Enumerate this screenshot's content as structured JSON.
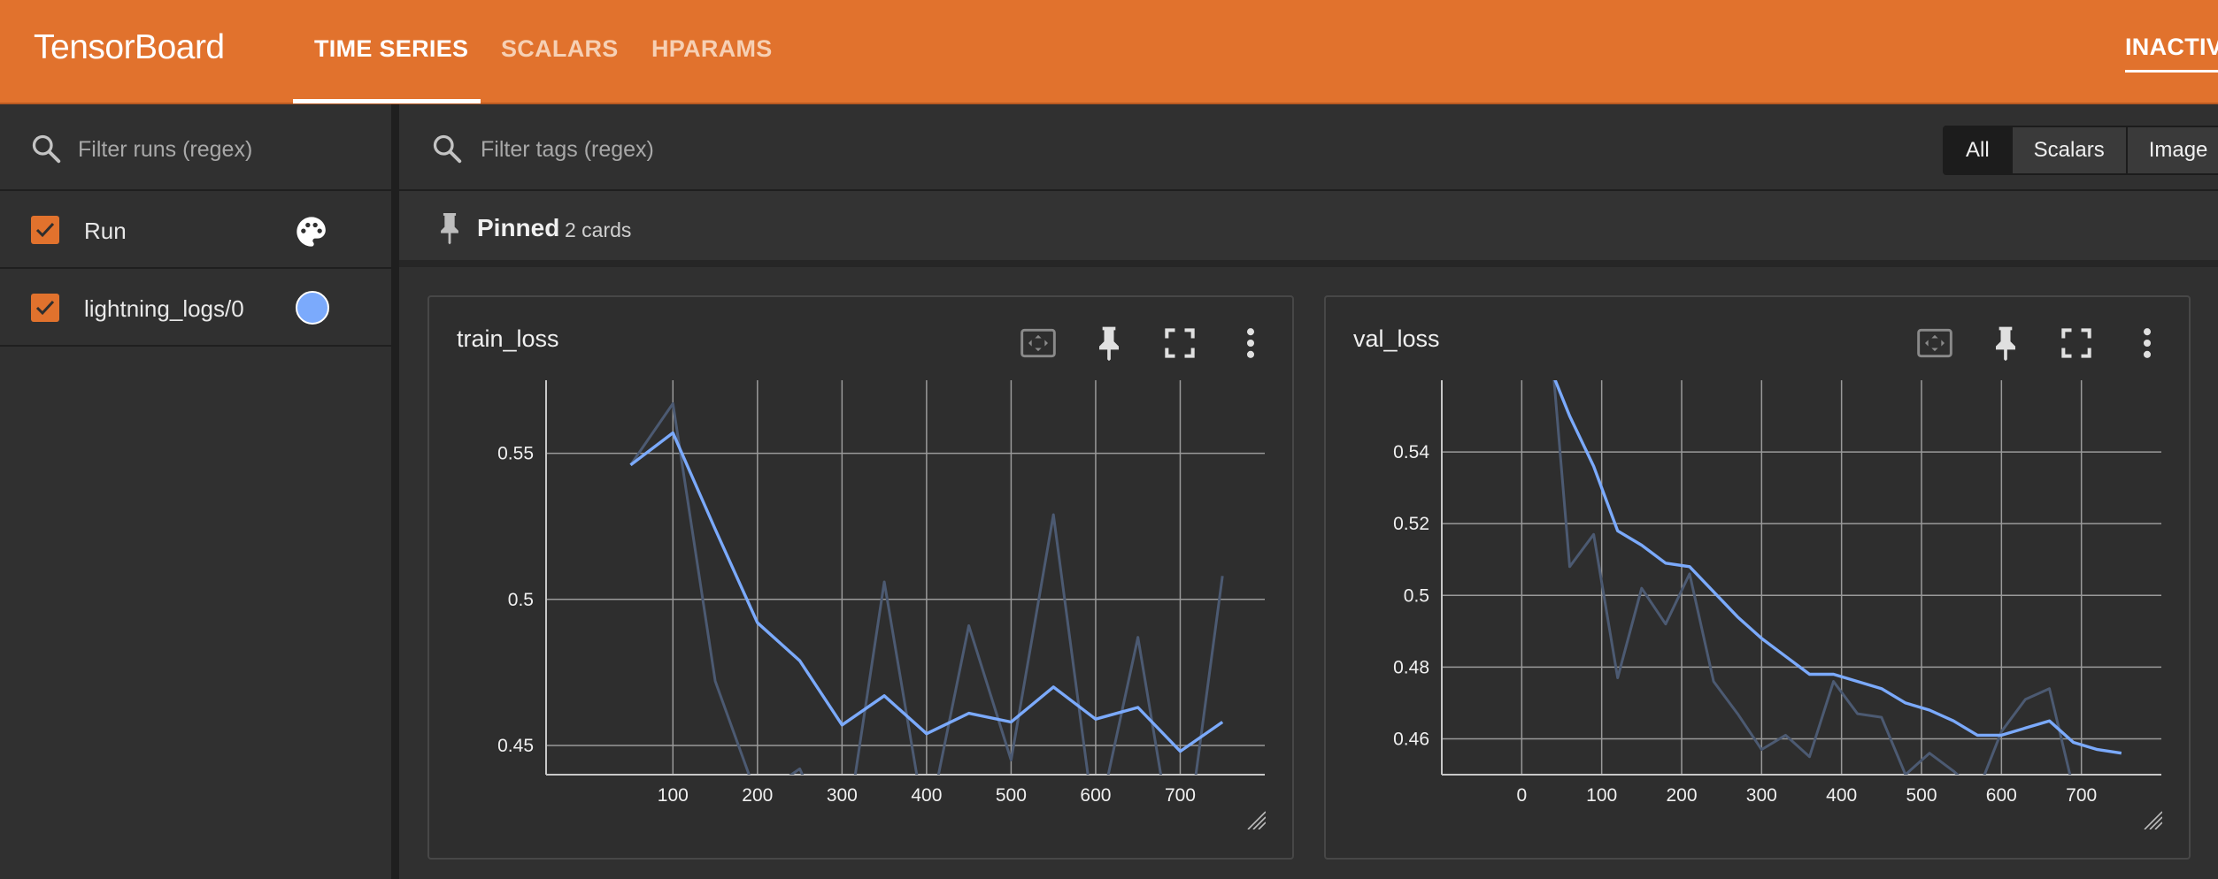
{
  "header": {
    "brand": "TensorBoard",
    "tabs": [
      {
        "label": "TIME SERIES",
        "active": true
      },
      {
        "label": "SCALARS",
        "active": false
      },
      {
        "label": "HPARAMS",
        "active": false
      }
    ],
    "status": "INACTIV"
  },
  "colors": {
    "brand": "#e1722d",
    "run_color": "#7baafc",
    "background": "#303030"
  },
  "sidebar": {
    "search_placeholder": "Filter runs (regex)",
    "search_icon": "search-icon",
    "runs": [
      {
        "label": "Run",
        "checked": true,
        "icon": "palette-icon"
      },
      {
        "label": "lightning_logs/0",
        "checked": true,
        "color": "#7baafc"
      }
    ]
  },
  "main": {
    "tags_placeholder": "Filter tags (regex)",
    "filter_types": [
      "All",
      "Scalars",
      "Image"
    ],
    "active_filter": "All",
    "pinned": {
      "title": "Pinned",
      "count_label": "2 cards",
      "icon": "pin-icon"
    },
    "card_actions": [
      "fit-domain-icon",
      "pin-icon",
      "fullscreen-icon",
      "more-vert-icon"
    ]
  },
  "chart_data": [
    {
      "type": "line",
      "title": "train_loss",
      "xlabel": "",
      "ylabel": "",
      "xlim": [
        -50,
        800
      ],
      "ylim": [
        0.44,
        0.575
      ],
      "x_ticks": [
        "100",
        "200",
        "300",
        "400",
        "500",
        "600",
        "700"
      ],
      "y_ticks": [
        "0.55",
        "0.5",
        "0.45"
      ],
      "grid": true,
      "series": [
        {
          "role": "smoothed",
          "x": [
            50,
            100,
            150,
            200,
            250,
            300,
            350,
            400,
            450,
            500,
            550,
            600,
            650,
            700,
            750
          ],
          "y": [
            0.546,
            0.557,
            0.524,
            0.492,
            0.479,
            0.457,
            0.467,
            0.454,
            0.461,
            0.458,
            0.47,
            0.459,
            0.463,
            0.448,
            0.458
          ]
        },
        {
          "role": "raw",
          "x": [
            50,
            100,
            150,
            200,
            250,
            300,
            350,
            400,
            450,
            500,
            550,
            600,
            650,
            700,
            750
          ],
          "y": [
            0.546,
            0.567,
            0.472,
            0.432,
            0.442,
            0.41,
            0.506,
            0.42,
            0.491,
            0.445,
            0.529,
            0.42,
            0.487,
            0.4,
            0.508
          ]
        }
      ]
    },
    {
      "type": "line",
      "title": "val_loss",
      "xlabel": "",
      "ylabel": "",
      "xlim": [
        -100,
        800
      ],
      "ylim": [
        0.45,
        0.56
      ],
      "x_ticks": [
        "0",
        "100",
        "200",
        "300",
        "400",
        "500",
        "600",
        "700"
      ],
      "y_ticks": [
        "0.54",
        "0.52",
        "0.5",
        "0.48",
        "0.46"
      ],
      "grid": true,
      "series": [
        {
          "role": "smoothed",
          "x": [
            40,
            60,
            90,
            120,
            150,
            180,
            210,
            240,
            270,
            300,
            330,
            360,
            390,
            420,
            450,
            480,
            510,
            540,
            570,
            600,
            630,
            660,
            690,
            720,
            750
          ],
          "y": [
            0.561,
            0.55,
            0.536,
            0.518,
            0.514,
            0.509,
            0.508,
            0.501,
            0.494,
            0.488,
            0.483,
            0.478,
            0.478,
            0.476,
            0.474,
            0.47,
            0.468,
            0.465,
            0.461,
            0.461,
            0.463,
            0.465,
            0.459,
            0.457,
            0.456
          ]
        },
        {
          "role": "raw",
          "x": [
            40,
            60,
            90,
            120,
            150,
            180,
            210,
            240,
            270,
            300,
            330,
            360,
            390,
            420,
            450,
            480,
            510,
            540,
            570,
            600,
            630,
            660,
            690,
            720,
            750
          ],
          "y": [
            0.561,
            0.508,
            0.517,
            0.477,
            0.502,
            0.492,
            0.506,
            0.476,
            0.467,
            0.457,
            0.461,
            0.455,
            0.476,
            0.467,
            0.466,
            0.45,
            0.456,
            0.451,
            0.445,
            0.462,
            0.471,
            0.474,
            0.446,
            0.44,
            0.44
          ]
        }
      ]
    }
  ]
}
